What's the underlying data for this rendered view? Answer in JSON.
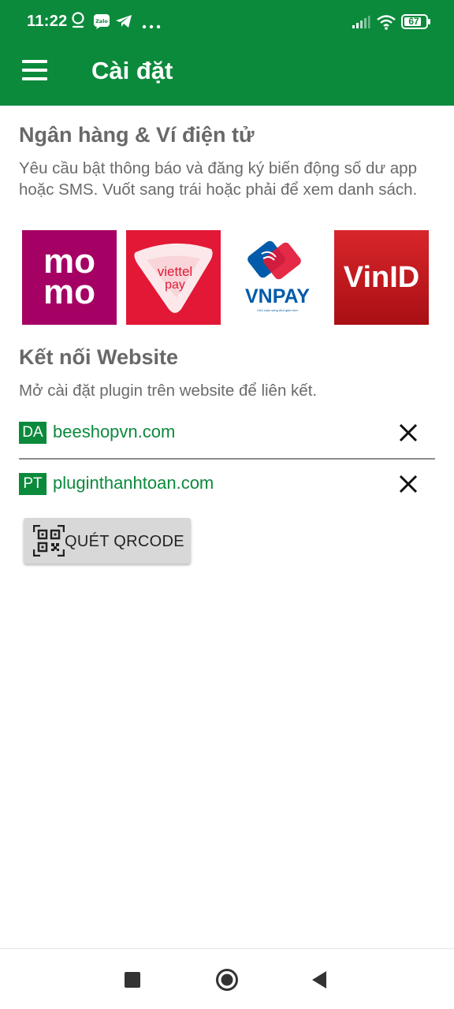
{
  "status_bar": {
    "time": "11:22",
    "battery": "67",
    "notification_icons": [
      "location-pin-icon",
      "zalo-icon",
      "telegram-icon",
      "more-dots-icon"
    ]
  },
  "app_bar": {
    "title": "Cài đặt",
    "color": "#0b8a3c"
  },
  "banks": {
    "title": "Ngân hàng & Ví điện tử",
    "description": "Yêu cầu bật thông báo và đăng ký biến động số dư app hoặc SMS. Vuốt sang trái hoặc phải để xem danh sách.",
    "items": [
      {
        "name": "momo",
        "label_top": "mo",
        "label_bottom": "mo",
        "color": "#a50064"
      },
      {
        "name": "viettel pay",
        "label_top": "viettel",
        "label_bottom": "pay",
        "color": "#e21836"
      },
      {
        "name": "VNPAY",
        "label": "VNPAY",
        "tagline": "Chủ cuộc sống đơn giản hơn",
        "color": "#005baa"
      },
      {
        "name": "VinID",
        "label": "VinID",
        "color": "#c4161c"
      }
    ]
  },
  "websites": {
    "title": "Kết nối Website",
    "description": "Mở cài đặt plugin trên website để liên kết.",
    "items": [
      {
        "badge": "DA",
        "domain": "beeshopvn.com"
      },
      {
        "badge": "PT",
        "domain": "pluginthanhtoan.com"
      }
    ],
    "scan_button": "QUÉT QRCODE"
  },
  "nav_bar": {
    "buttons": [
      "recents-square-icon",
      "home-circle-icon",
      "back-triangle-icon"
    ]
  }
}
